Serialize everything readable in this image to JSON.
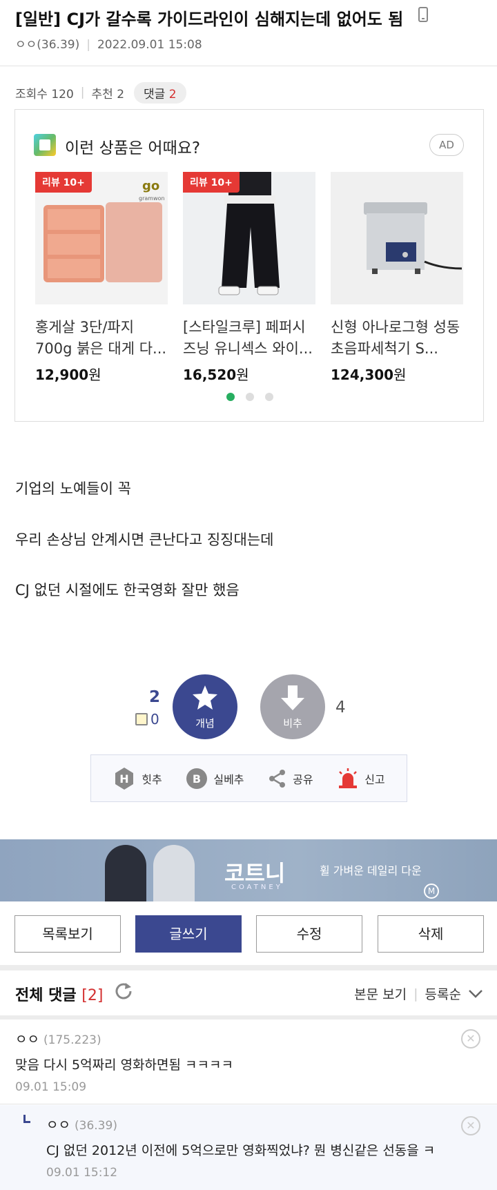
{
  "post": {
    "title": "[일반] CJ가 갈수록 가이드라인이 심해지는데 없어도 됨",
    "author": "ㅇㅇ(36.39)",
    "date": "2022.09.01 15:08",
    "views_label": "조회수 120",
    "recommend_label": "추천 2",
    "comments_label": "댓글",
    "comments_count": "2"
  },
  "ad": {
    "heading": "이런 상품은 어때요?",
    "badge": "AD",
    "products": [
      {
        "tag": "리뷰 10+",
        "name": "홍게살 3단/파지 700g 붉은 대게 다...",
        "price": "12,900",
        "won": "원",
        "brand": "go",
        "brand_sub": "gramwon"
      },
      {
        "tag": "리뷰 10+",
        "name": "[스타일크루] 페퍼시즈닝 유니섹스 와이...",
        "price": "16,520",
        "won": "원"
      },
      {
        "name": "신형 아나로그형 성동초음파세척기 S...",
        "price": "124,300",
        "won": "원"
      }
    ]
  },
  "body": {
    "lines": [
      "기업의 노예들이 꼭",
      "우리 손상님 안계시면 큰난다고 징징대는데",
      "CJ 없던 시절에도 한국영화 잘만 했음"
    ]
  },
  "votes": {
    "up_count": "2",
    "fix_count": "0",
    "up_label": "개념",
    "down_label": "비추",
    "down_count": "4"
  },
  "actions": {
    "hit": "힛추",
    "best": "실베추",
    "share": "공유",
    "report": "신고"
  },
  "banner": {
    "brand": "코트니",
    "brand_sub": "COATNEY",
    "tagline": "휠 가벼운 데일리 다운",
    "badge": "M"
  },
  "buttons": {
    "list": "목록보기",
    "write": "글쓰기",
    "edit": "수정",
    "delete": "삭제"
  },
  "comments_header": {
    "title": "전체 댓글",
    "count": "[2]",
    "view_body": "본문 보기",
    "sort": "등록순"
  },
  "comments": [
    {
      "author": "ㅇㅇ",
      "ip": "(175.223)",
      "text": "맞음 다시 5억짜리 영화하면됨 ㅋㅋㅋㅋ",
      "time": "09.01 15:09"
    },
    {
      "author": "ㅇㅇ",
      "ip": "(36.39)",
      "text": "CJ 없던 2012년 이전에 5억으로만 영화찍었냐? 뭔 병신같은 선동을 ㅋ",
      "time": "09.01 15:12"
    }
  ]
}
